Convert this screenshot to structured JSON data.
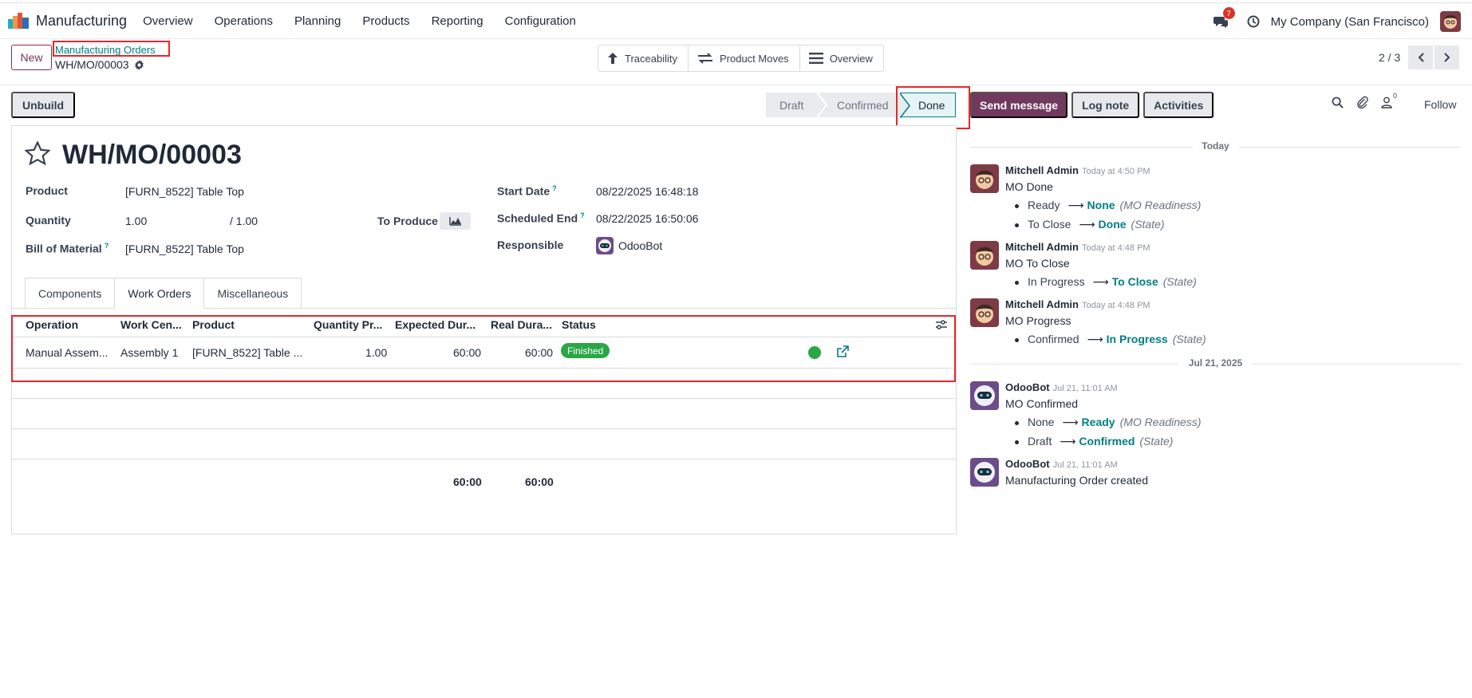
{
  "app": {
    "name": "Manufacturing"
  },
  "menu": [
    "Overview",
    "Operations",
    "Planning",
    "Products",
    "Reporting",
    "Configuration"
  ],
  "systray": {
    "message_count": "7",
    "company": "My Company (San Francisco)"
  },
  "control_panel": {
    "new_label": "New",
    "breadcrumb": "Manufacturing Orders",
    "record_name": "WH/MO/00003",
    "smart_buttons": [
      "Traceability",
      "Product Moves",
      "Overview"
    ],
    "pager": "2 / 3"
  },
  "actions": {
    "unbuild": "Unbuild"
  },
  "status": {
    "steps": [
      "Draft",
      "Confirmed",
      "Done"
    ],
    "current": "Done"
  },
  "chatter_buttons": {
    "send": "Send message",
    "log": "Log note",
    "activities": "Activities",
    "followers": "0",
    "follow": "Follow"
  },
  "form": {
    "title": "WH/MO/00003",
    "product_label": "Product",
    "product_value": "[FURN_8522] Table Top",
    "quantity_label": "Quantity",
    "quantity_value": "1.00",
    "quantity_total": "/ 1.00",
    "to_produce_label": "To Produce",
    "bom_label": "Bill of Material",
    "bom_value": "[FURN_8522] Table Top",
    "start_label": "Start Date",
    "start_value": "08/22/2025 16:48:18",
    "sched_label": "Scheduled End",
    "sched_value": "08/22/2025 16:50:06",
    "resp_label": "Responsible",
    "resp_value": "OdooBot"
  },
  "tabs": [
    "Components",
    "Work Orders",
    "Miscellaneous"
  ],
  "table": {
    "headers": [
      "Operation",
      "Work Cen...",
      "Product",
      "Quantity Pr...",
      "Expected Dur...",
      "Real Dura...",
      "Status"
    ],
    "rows": [
      {
        "operation": "Manual Assem...",
        "work_center": "Assembly 1",
        "product": "[FURN_8522] Table ...",
        "quantity": "1.00",
        "expected": "60:00",
        "real": "60:00",
        "status": "Finished"
      }
    ],
    "totals": {
      "expected": "60:00",
      "real": "60:00"
    }
  },
  "chatter": {
    "groups": [
      {
        "date": "Today",
        "messages": [
          {
            "author": "Mitchell Admin",
            "when": "Today at 4:50 PM",
            "body": "MO Done",
            "tracking": [
              {
                "old": "Ready",
                "new": "None",
                "field": "(MO Readiness)"
              },
              {
                "old": "To Close",
                "new": "Done",
                "field": "(State)"
              }
            ]
          },
          {
            "author": "Mitchell Admin",
            "when": "Today at 4:48 PM",
            "body": "MO To Close",
            "tracking": [
              {
                "old": "In Progress",
                "new": "To Close",
                "field": "(State)"
              }
            ]
          },
          {
            "author": "Mitchell Admin",
            "when": "Today at 4:48 PM",
            "body": "MO Progress",
            "tracking": [
              {
                "old": "Confirmed",
                "new": "In Progress",
                "field": "(State)"
              }
            ]
          }
        ]
      },
      {
        "date": "Jul 21, 2025",
        "messages": [
          {
            "author": "OdooBot",
            "when": "Jul 21, 11:01 AM",
            "body": "MO Confirmed",
            "tracking": [
              {
                "old": "None",
                "new": "Ready",
                "field": "(MO Readiness)"
              },
              {
                "old": "Draft",
                "new": "Confirmed",
                "field": "(State)"
              }
            ]
          },
          {
            "author": "OdooBot",
            "when": "Jul 21, 11:01 AM",
            "body": "Manufacturing Order created",
            "tracking": []
          }
        ]
      }
    ]
  }
}
